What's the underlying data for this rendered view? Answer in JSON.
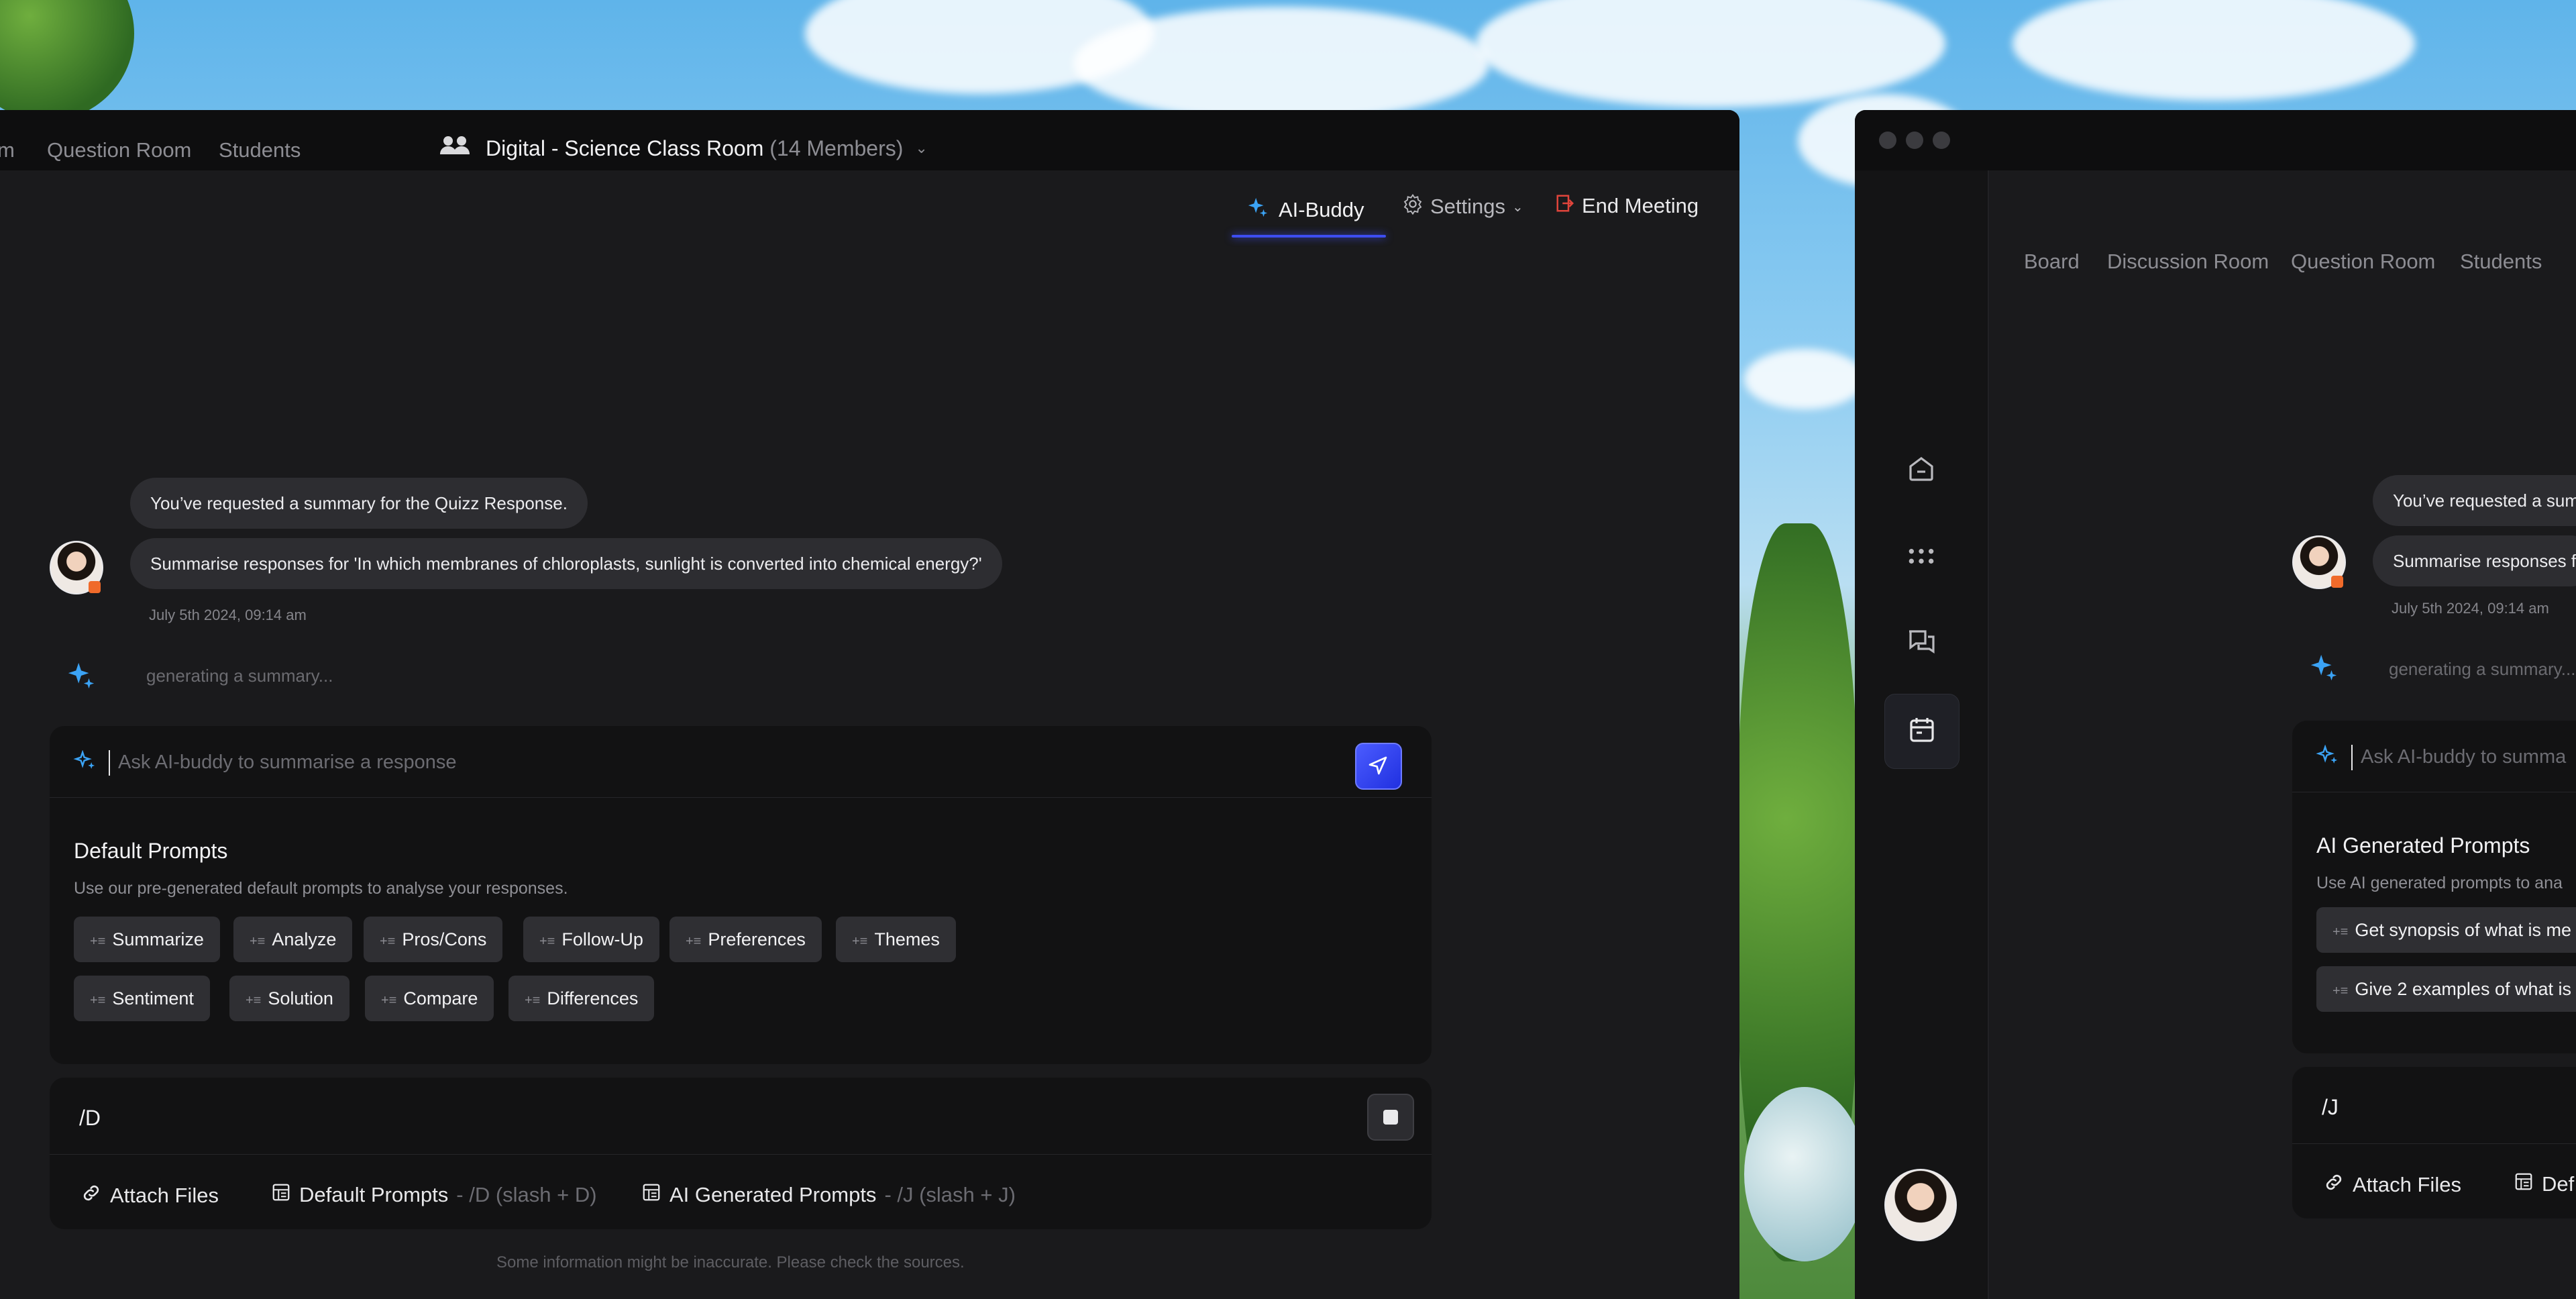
{
  "left_window": {
    "nav": {
      "partial_tab": "m",
      "question_room": "Question Room",
      "students": "Students"
    },
    "room": {
      "name": "Digital  - Science Class Room",
      "members": "(14 Members)"
    },
    "header_actions": {
      "ai_buddy": "AI-Buddy",
      "settings": "Settings",
      "end_meeting": "End Meeting"
    },
    "chat": {
      "message_1": "You’ve requested a summary for the Quizz Response.",
      "message_2": "Summarise responses for 'In which membranes of chloroplasts, sunlight is converted into chemical energy?'",
      "timestamp": "July 5th 2024, 09:14 am",
      "generating": "generating a summary..."
    },
    "ask": {
      "placeholder": "Ask AI-buddy to summarise a response"
    },
    "default_prompts": {
      "title": "Default Prompts",
      "subtitle": "Use our pre-generated  default prompts to analyse your responses.",
      "row1": [
        "Summarize",
        "Analyze",
        "Pros/Cons",
        "Follow-Up",
        "Preferences",
        "Themes"
      ],
      "row2": [
        "Sentiment",
        "Solution",
        "Compare",
        "Differences"
      ]
    },
    "command": {
      "text": "/D",
      "attach_files": "Attach Files",
      "default_prompts": "Default Prompts",
      "default_prompts_hint": "- /D (slash + D)",
      "ai_generated_prompts": "AI Generated Prompts",
      "ai_generated_prompts_hint": "- /J (slash + J)"
    },
    "disclaimer": "Some information might be inaccurate. Please check the sources."
  },
  "right_window": {
    "nav": {
      "board": "Board",
      "discussion_room": "Discussion Room",
      "question_room": "Question Room",
      "students": "Students"
    },
    "chat": {
      "message_1": "You’ve requested a sum",
      "message_2": "Summarise responses f",
      "timestamp": "July 5th 2024, 09:14 am",
      "generating": "generating a summary..."
    },
    "ask": {
      "placeholder": "Ask AI-buddy to summa"
    },
    "ai_prompts": {
      "title": "AI Generated Prompts",
      "subtitle": "Use AI generated prompts to ana",
      "items": [
        "Get synopsis of what is me",
        "Give 2 examples of what is c"
      ]
    },
    "command": {
      "text": "/J",
      "attach_files": "Attach Files",
      "default_prompts_partial": "Def"
    },
    "sidebar_icons": [
      "home-icon",
      "apps-grid-icon",
      "chat-icon",
      "calendar-icon"
    ]
  },
  "colors": {
    "accent_blue": "#3d4df0",
    "ai_sparkle": "#3ba3f5",
    "end_meeting_red": "#e0443b",
    "status_orange": "#f06a2a"
  }
}
